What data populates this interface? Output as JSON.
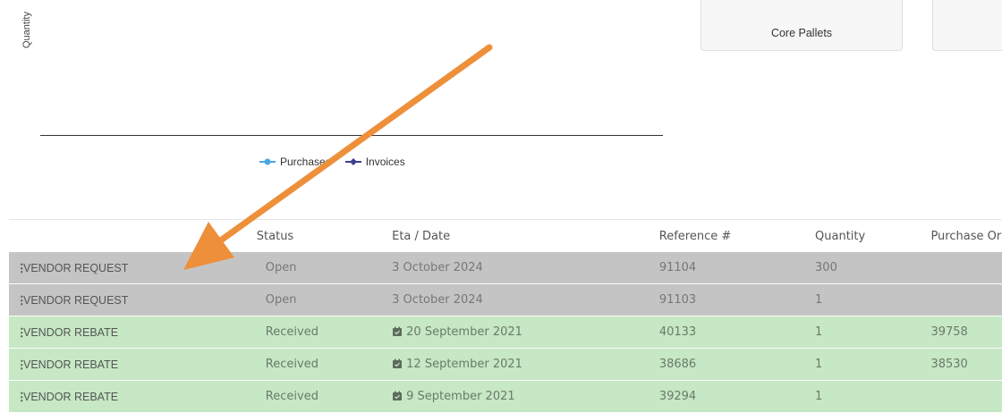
{
  "chart": {
    "y_label": "Quantity",
    "legend": [
      {
        "label": "Purchases",
        "color": "#4aa8e0"
      },
      {
        "label": "Invoices",
        "color": "#3a3f8f"
      }
    ]
  },
  "cards": [
    {
      "label": "Core Pallets"
    },
    {
      "label": ""
    }
  ],
  "table": {
    "headers": [
      "",
      "Status",
      "Eta / Date",
      "Reference #",
      "Quantity",
      "Purchase Or"
    ],
    "rows": [
      {
        "type": "VENDOR REQUEST",
        "status": "Open",
        "date": "3 October 2024",
        "ref": "91104",
        "qty": "300",
        "po": "",
        "style": "grey",
        "icon": false
      },
      {
        "type": "VENDOR REQUEST",
        "status": "Open",
        "date": "3 October 2024",
        "ref": "91103",
        "qty": "1",
        "po": "",
        "style": "grey",
        "icon": false
      },
      {
        "type": "VENDOR REBATE",
        "status": "Received",
        "date": "20 September 2021",
        "ref": "40133",
        "qty": "1",
        "po": "39758",
        "style": "green",
        "icon": true
      },
      {
        "type": "VENDOR REBATE",
        "status": "Received",
        "date": "12 September 2021",
        "ref": "38686",
        "qty": "1",
        "po": "38530",
        "style": "green",
        "icon": true
      },
      {
        "type": "VENDOR REBATE",
        "status": "Received",
        "date": "9 September 2021",
        "ref": "39294",
        "qty": "1",
        "po": "",
        "style": "green",
        "icon": true
      }
    ]
  },
  "annotation": {
    "arrow_color": "#ee8f3a"
  }
}
